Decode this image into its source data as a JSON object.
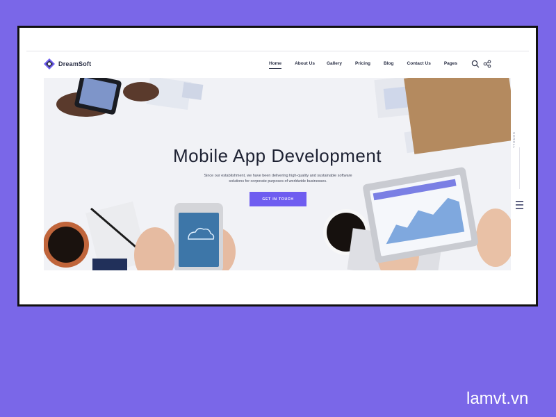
{
  "brand": {
    "name": "DreamSoft"
  },
  "nav": {
    "items": [
      "Home",
      "About Us",
      "Gallery",
      "Pricing",
      "Blog",
      "Contact Us",
      "Pages"
    ],
    "active": "Home"
  },
  "icons": {
    "search": "search-icon",
    "share": "share-icon",
    "menu": "menu-icon",
    "logo": "logo-icon"
  },
  "hero": {
    "title": "Mobile App Development",
    "subtitle": "Since our establishment, we have been delivering high-quality and sustainable software solutions for corporate purposes of worldwide businesses.",
    "cta": "GET IN TOUCH"
  },
  "side": {
    "scroll_label": "SCROLL"
  },
  "watermark": "lamvt.vn",
  "colors": {
    "accent": "#6f5df0",
    "page_background": "#7a67e8",
    "frame_border": "#111111"
  }
}
